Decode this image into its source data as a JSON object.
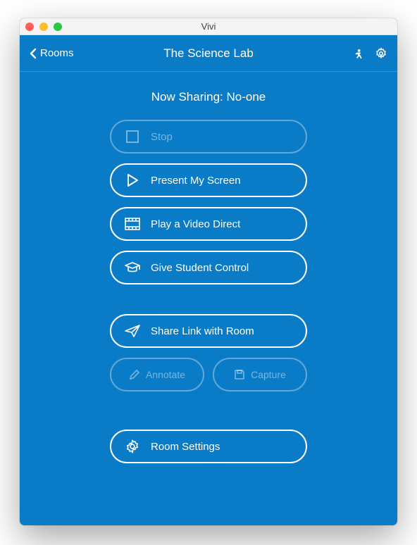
{
  "window": {
    "title": "Vivi"
  },
  "header": {
    "back_label": "Rooms",
    "title": "The Science Lab"
  },
  "status": {
    "text": "Now Sharing: No-one"
  },
  "buttons": {
    "stop": "Stop",
    "present": "Present My Screen",
    "play_video": "Play a Video Direct",
    "student_control": "Give Student Control",
    "share_link": "Share Link with Room",
    "annotate": "Annotate",
    "capture": "Capture",
    "room_settings": "Room Settings"
  }
}
